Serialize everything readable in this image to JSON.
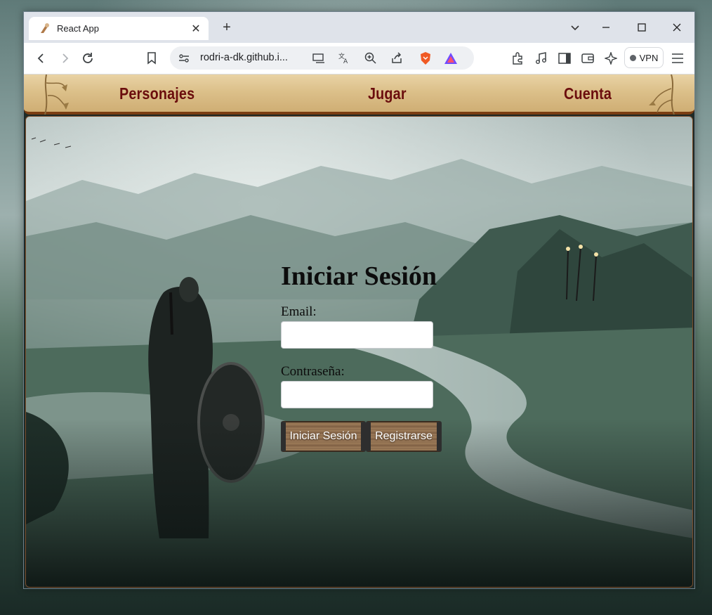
{
  "browser": {
    "tab_title": "React App",
    "url": "rodri-a-dk.github.i...",
    "vpn_label": "VPN"
  },
  "navbar": {
    "items": [
      {
        "label": "Personajes"
      },
      {
        "label": "Jugar"
      },
      {
        "label": "Cuenta"
      }
    ]
  },
  "login": {
    "title": "Iniciar Sesión",
    "email_label": "Email:",
    "email_value": "",
    "password_label": "Contraseña:",
    "password_value": "",
    "login_button": "Iniciar Sesión",
    "register_button": "Registrarse"
  },
  "colors": {
    "nav_text": "#6b0d0d",
    "nav_border": "#7a3d12",
    "parchment": "#dcc08a"
  }
}
